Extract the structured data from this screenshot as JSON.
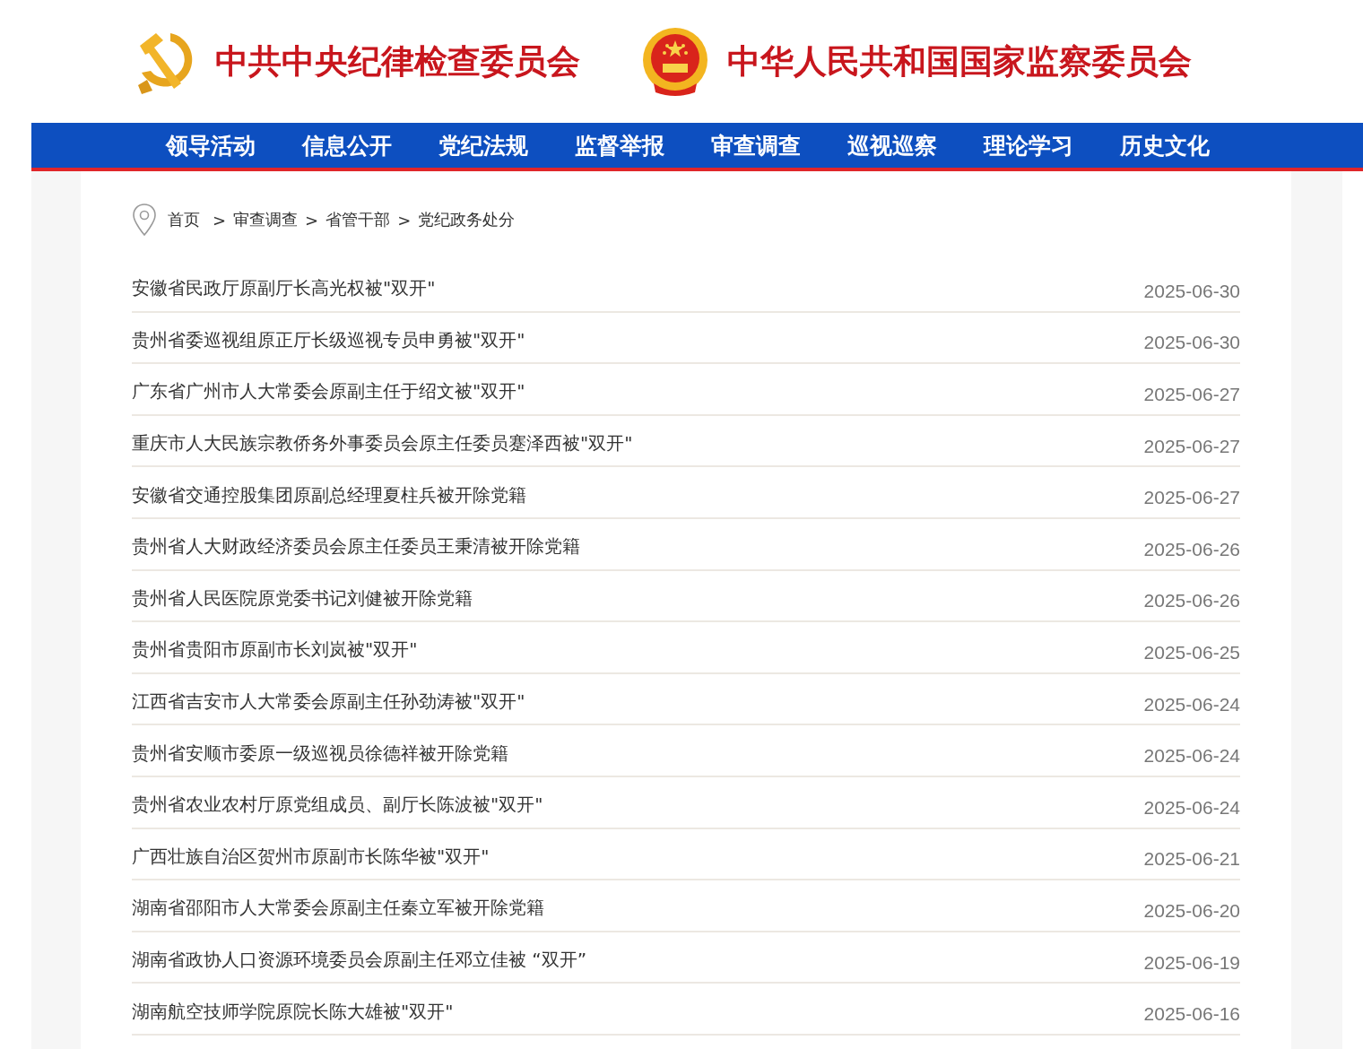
{
  "header": {
    "titles": [
      "中共中央纪律检查委员会",
      "中华人民共和国国家监察委员会"
    ]
  },
  "nav": {
    "items": [
      {
        "label": "领导活动",
        "selected": false
      },
      {
        "label": "信息公开",
        "selected": false
      },
      {
        "label": "党纪法规",
        "selected": false
      },
      {
        "label": "监督举报",
        "selected": false
      },
      {
        "label": "审查调查",
        "selected": false
      },
      {
        "label": "巡视巡察",
        "selected": false
      },
      {
        "label": "理论学习",
        "selected": false
      },
      {
        "label": "历史文化",
        "selected": false
      }
    ]
  },
  "breadcrumb": {
    "items": [
      "首页",
      "审查调查",
      "省管干部",
      "党纪政务处分"
    ],
    "separator": ">"
  },
  "articles": [
    {
      "title": "安徽省民政厅原副厅长高光权被\"双开\"",
      "date": "2025-06-30"
    },
    {
      "title": "贵州省委巡视组原正厅长级巡视专员申勇被\"双开\"",
      "date": "2025-06-30"
    },
    {
      "title": "广东省广州市人大常委会原副主任于绍文被\"双开\"",
      "date": "2025-06-27"
    },
    {
      "title": "重庆市人大民族宗教侨务外事委员会原主任委员蹇泽西被\"双开\"",
      "date": "2025-06-27"
    },
    {
      "title": "安徽省交通控股集团原副总经理夏柱兵被开除党籍",
      "date": "2025-06-27"
    },
    {
      "title": "贵州省人大财政经济委员会原主任委员王秉清被开除党籍",
      "date": "2025-06-26"
    },
    {
      "title": "贵州省人民医院原党委书记刘健被开除党籍",
      "date": "2025-06-26"
    },
    {
      "title": "贵州省贵阳市原副市长刘岚被\"双开\"",
      "date": "2025-06-25"
    },
    {
      "title": "江西省吉安市人大常委会原副主任孙劲涛被\"双开\"",
      "date": "2025-06-24"
    },
    {
      "title": "贵州省安顺市委原一级巡视员徐德祥被开除党籍",
      "date": "2025-06-24"
    },
    {
      "title": "贵州省农业农村厅原党组成员、副厅长陈波被\"双开\"",
      "date": "2025-06-24"
    },
    {
      "title": "广西壮族自治区贺州市原副市长陈华被\"双开\"",
      "date": "2025-06-21"
    },
    {
      "title": "湖南省邵阳市人大常委会原副主任秦立军被开除党籍",
      "date": "2025-06-20"
    },
    {
      "title": "湖南省政协人口资源环境委员会原副主任邓立佳被 “双开”",
      "date": "2025-06-19"
    },
    {
      "title": "湖南航空技师学院原院长陈大雄被\"双开\"",
      "date": "2025-06-16"
    }
  ]
}
